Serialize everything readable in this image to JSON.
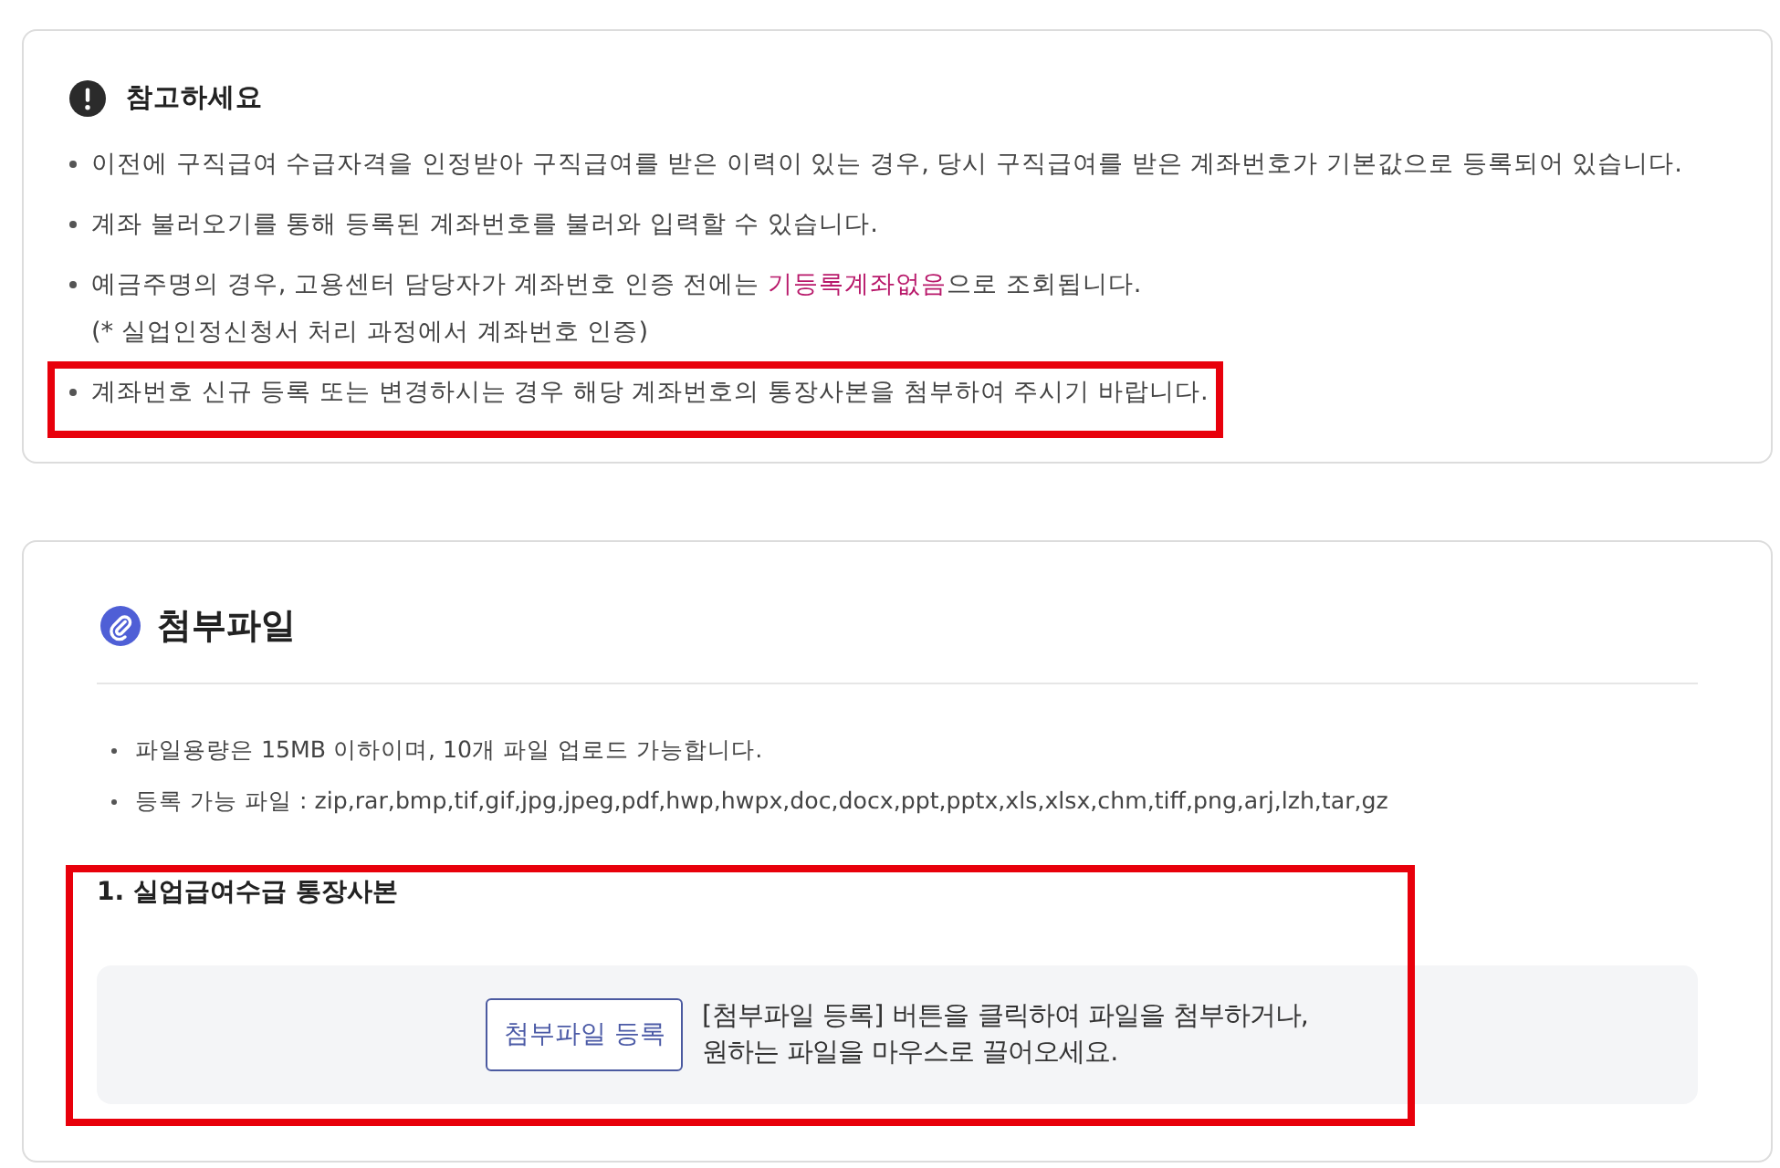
{
  "notice": {
    "title": "참고하세요",
    "items": [
      {
        "segments": [
          {
            "text": "이전에 구직급여 수급자격을 인정받아 구직급여를 받은 이력이 있는 경우, 당시 구직급여를 받은 계좌번호가 기본값으로 등록되어 있습니다.",
            "emphasized": false
          }
        ],
        "highlighted": false
      },
      {
        "segments": [
          {
            "text": "계좌 불러오기를 통해 등록된 계좌번호를 불러와 입력할 수 있습니다.",
            "emphasized": false
          }
        ],
        "highlighted": false
      },
      {
        "segments": [
          {
            "text": "예금주명의 경우, 고용센터 담당자가 계좌번호 인증 전에는 ",
            "emphasized": false
          },
          {
            "text": "기등록계좌없음",
            "emphasized": true
          },
          {
            "text": "으로 조회됩니다.",
            "emphasized": false
          }
        ],
        "note": "(* 실업인정신청서 처리 과정에서 계좌번호 인증)",
        "highlighted": false
      },
      {
        "segments": [
          {
            "text": "계좌번호 신규 등록 또는 변경하시는 경우 해당 계좌번호의 통장사본을 첨부하여 주시기 바랍니다.",
            "emphasized": false
          }
        ],
        "highlighted": true
      }
    ]
  },
  "attachments": {
    "title": "첨부파일",
    "info": [
      "파일용량은 15MB 이하이며, 10개 파일 업로드 가능합니다.",
      "등록 가능 파일 : zip,rar,bmp,tif,gif,jpg,jpeg,pdf,hwp,hwpx,doc,docx,ppt,pptx,xls,xlsx,chm,tiff,png,arj,lzh,tar,gz"
    ],
    "uploads": [
      {
        "label": "1. 실업급여수급 통장사본",
        "button": "첨부파일 등록",
        "hint": "[첨부파일 등록] 버튼을 클릭하여 파일을 첨부하거나,\n원하는 파일을 마우스로 끌어오세요.",
        "highlighted": true
      }
    ]
  }
}
